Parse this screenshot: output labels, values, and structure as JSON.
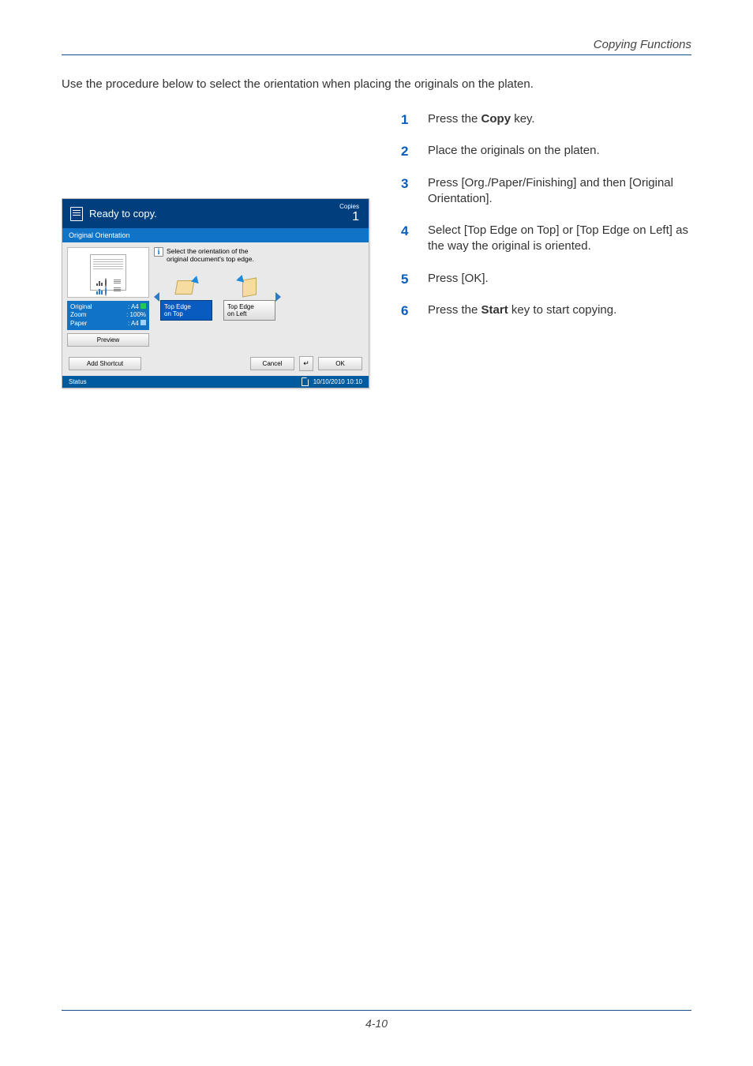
{
  "header": {
    "running": "Copying Functions"
  },
  "intro": "Use the procedure below to select the orientation when placing the originals on the platen.",
  "steps": {
    "s1a": "Press the ",
    "s1b": "Copy",
    "s1c": " key.",
    "s2": "Place the originals on the platen.",
    "s3": "Press [Org./Paper/Finishing] and then [Original Orientation].",
    "s4": "Select [Top Edge on Top] or [Top Edge on Left] as the way the original is oriented.",
    "s5": "Press [OK].",
    "s6a": "Press the ",
    "s6b": "Start",
    "s6c": " key to start copying."
  },
  "panel": {
    "title": "Ready to copy.",
    "copies_label": "Copies",
    "copies_value": "1",
    "subtitle": "Original Orientation",
    "hint_line1": "Select the orientation of the",
    "hint_line2": "original document's top edge.",
    "meta": {
      "original_label": "Original",
      "original_value": ": A4",
      "zoom_label": "Zoom",
      "zoom_value": ": 100%",
      "paper_label": "Paper",
      "paper_value": ": A4"
    },
    "preview_btn": "Preview",
    "options": {
      "top_line1": "Top Edge",
      "top_line2": "on Top",
      "left_line1": "Top Edge",
      "left_line2": "on Left"
    },
    "add_shortcut": "Add Shortcut",
    "cancel": "Cancel",
    "back_glyph": "↵",
    "ok": "OK",
    "status_label": "Status",
    "datetime": "10/10/2010  10:10"
  },
  "page_number": "4-10"
}
